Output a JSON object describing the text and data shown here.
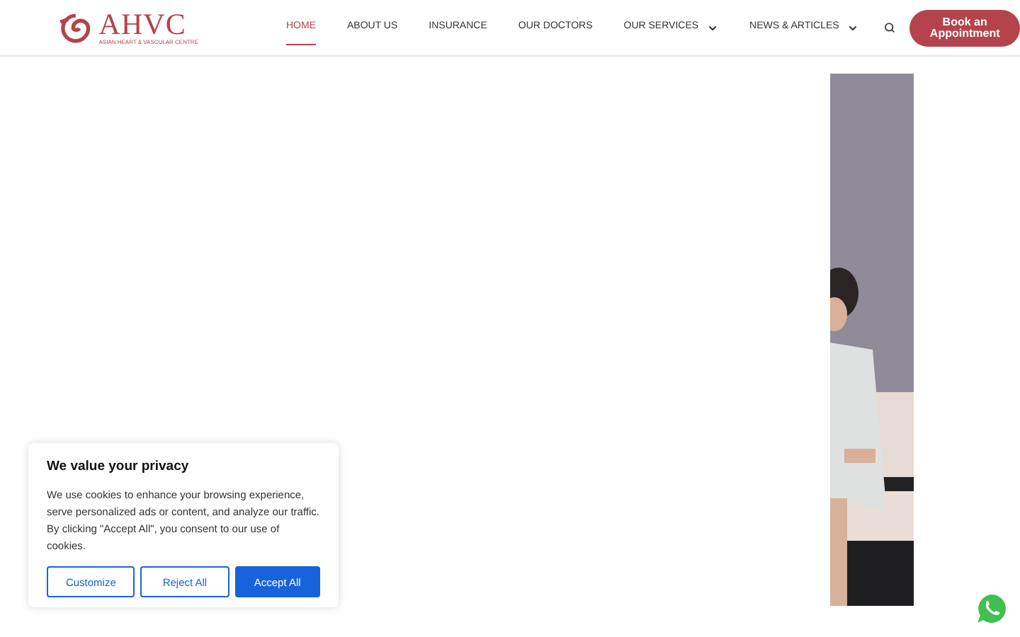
{
  "logo": {
    "name": "AHVC",
    "tagline": "ASIAN HEART & VASCULAR CENTRE"
  },
  "nav": [
    {
      "label": "HOME",
      "selected": true,
      "dropdown": false
    },
    {
      "label": "ABOUT US",
      "selected": false,
      "dropdown": false
    },
    {
      "label": "INSURANCE",
      "selected": false,
      "dropdown": false
    },
    {
      "label": "OUR DOCTORS",
      "selected": false,
      "dropdown": false
    },
    {
      "label": "OUR SERVICES",
      "selected": false,
      "dropdown": true
    },
    {
      "label": "NEWS & ARTICLES",
      "selected": false,
      "dropdown": true
    }
  ],
  "cta": "Book an Appointment",
  "cookie": {
    "title": "We value your privacy",
    "text": "We use cookies to enhance your browsing experience, serve personalized ads or content, and analyze our traffic. By clicking \"Accept All\", you consent to our use of cookies.",
    "buttons": [
      {
        "label": "Customize",
        "kind": "outline"
      },
      {
        "label": "Reject All",
        "kind": "outline"
      },
      {
        "label": "Accept All",
        "kind": "primary"
      }
    ]
  }
}
